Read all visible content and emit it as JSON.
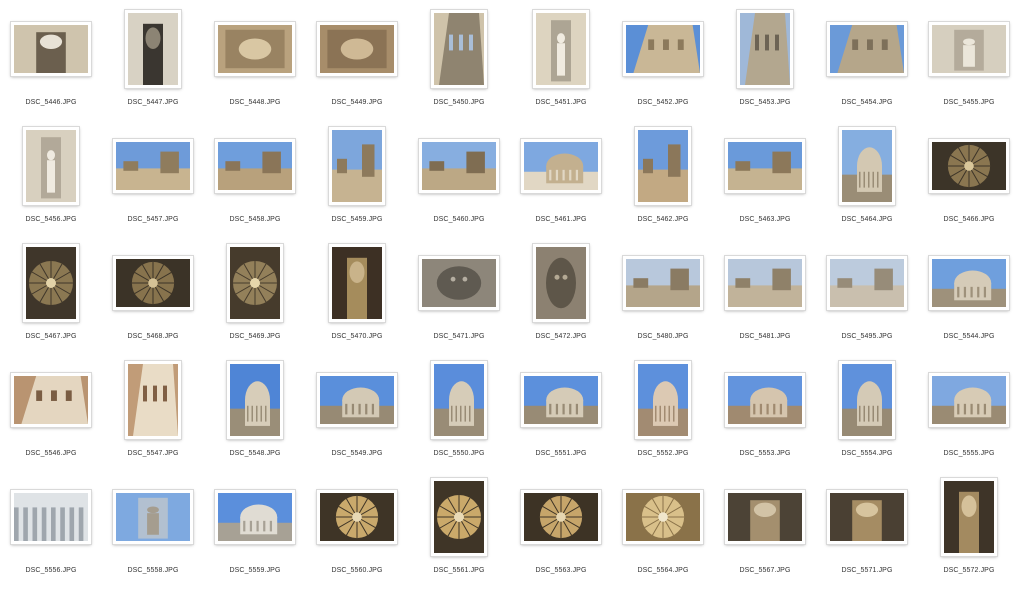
{
  "files": [
    {
      "name": "DSC_5446.JPG",
      "orientation": "landscape",
      "colors": [
        "#cfc4ad",
        "#6b5f4e",
        "#e8e2d6"
      ],
      "icon": "colonnade"
    },
    {
      "name": "DSC_5447.JPG",
      "orientation": "portrait",
      "colors": [
        "#d8d2c4",
        "#3a3630",
        "#8c8474"
      ],
      "icon": "arch"
    },
    {
      "name": "DSC_5448.JPG",
      "orientation": "landscape",
      "colors": [
        "#b9a27e",
        "#7a6446",
        "#d9c7a3"
      ],
      "icon": "ceiling"
    },
    {
      "name": "DSC_5449.JPG",
      "orientation": "landscape",
      "colors": [
        "#a78d6a",
        "#6f5a3f",
        "#cfb995"
      ],
      "icon": "ceiling"
    },
    {
      "name": "DSC_5450.JPG",
      "orientation": "portrait",
      "colors": [
        "#cfc3aa",
        "#8f8470",
        "#a9bed8"
      ],
      "icon": "facade"
    },
    {
      "name": "DSC_5451.JPG",
      "orientation": "portrait",
      "colors": [
        "#ddd4c0",
        "#8e8676",
        "#f0ebe0"
      ],
      "icon": "statue"
    },
    {
      "name": "DSC_5452.JPG",
      "orientation": "landscape",
      "colors": [
        "#5b8fd6",
        "#c9b796",
        "#8c7a5c"
      ],
      "icon": "facade"
    },
    {
      "name": "DSC_5453.JPG",
      "orientation": "portrait",
      "colors": [
        "#9fb8d8",
        "#b3a78f",
        "#6c6354"
      ],
      "icon": "facade"
    },
    {
      "name": "DSC_5454.JPG",
      "orientation": "landscape",
      "colors": [
        "#6b9ad8",
        "#b5a68a",
        "#7d705a"
      ],
      "icon": "facade"
    },
    {
      "name": "DSC_5455.JPG",
      "orientation": "landscape",
      "colors": [
        "#d6cfbf",
        "#9c9384",
        "#ebe6da"
      ],
      "icon": "statue"
    },
    {
      "name": "DSC_5456.JPG",
      "orientation": "portrait",
      "colors": [
        "#d8d0bf",
        "#9a9080",
        "#efeae0"
      ],
      "icon": "statue"
    },
    {
      "name": "DSC_5457.JPG",
      "orientation": "landscape",
      "colors": [
        "#6e9bd9",
        "#c8b490",
        "#8f7c5d"
      ],
      "icon": "rooftop"
    },
    {
      "name": "DSC_5458.JPG",
      "orientation": "landscape",
      "colors": [
        "#6f9edc",
        "#b8a17c",
        "#8a7558"
      ],
      "icon": "rooftop"
    },
    {
      "name": "DSC_5459.JPG",
      "orientation": "portrait",
      "colors": [
        "#7da6dc",
        "#c6b391",
        "#8d7a5c"
      ],
      "icon": "rooftop"
    },
    {
      "name": "DSC_5460.JPG",
      "orientation": "landscape",
      "colors": [
        "#87aee0",
        "#bca885",
        "#7f6d52"
      ],
      "icon": "rooftop"
    },
    {
      "name": "DSC_5461.JPG",
      "orientation": "landscape",
      "colors": [
        "#7ea8e0",
        "#c3b08f",
        "#e1d7c4"
      ],
      "icon": "dome"
    },
    {
      "name": "DSC_5462.JPG",
      "orientation": "portrait",
      "colors": [
        "#6d9bdb",
        "#c2a983",
        "#8b775a"
      ],
      "icon": "rooftop"
    },
    {
      "name": "DSC_5463.JPG",
      "orientation": "landscape",
      "colors": [
        "#6a9ada",
        "#c5b391",
        "#8c785a"
      ],
      "icon": "rooftop"
    },
    {
      "name": "DSC_5464.JPG",
      "orientation": "portrait",
      "colors": [
        "#85aee0",
        "#d3c8b2",
        "#9a8d76"
      ],
      "icon": "dome"
    },
    {
      "name": "DSC_5466.JPG",
      "orientation": "landscape",
      "colors": [
        "#3c3428",
        "#8a7650",
        "#d9c79a"
      ],
      "icon": "cupola"
    },
    {
      "name": "DSC_5467.JPG",
      "orientation": "portrait",
      "colors": [
        "#3f362a",
        "#8b7852",
        "#e3d3a8"
      ],
      "icon": "cupola"
    },
    {
      "name": "DSC_5468.JPG",
      "orientation": "landscape",
      "colors": [
        "#3b3327",
        "#87734d",
        "#d5c296"
      ],
      "icon": "cupola"
    },
    {
      "name": "DSC_5469.JPG",
      "orientation": "portrait",
      "colors": [
        "#463b2c",
        "#93805a",
        "#e6d6ab"
      ],
      "icon": "cupola"
    },
    {
      "name": "DSC_5470.JPG",
      "orientation": "portrait",
      "colors": [
        "#3d3024",
        "#a58c5c",
        "#c9b38a"
      ],
      "icon": "interior"
    },
    {
      "name": "DSC_5471.JPG",
      "orientation": "landscape",
      "colors": [
        "#8d867a",
        "#5f5a51",
        "#b5aea1"
      ],
      "icon": "mosaic"
    },
    {
      "name": "DSC_5472.JPG",
      "orientation": "portrait",
      "colors": [
        "#8c8171",
        "#5e5649",
        "#b4a994"
      ],
      "icon": "mosaic"
    },
    {
      "name": "DSC_5480.JPG",
      "orientation": "landscape",
      "colors": [
        "#b8c8dc",
        "#b4a58a",
        "#8a7b63"
      ],
      "icon": "city"
    },
    {
      "name": "DSC_5481.JPG",
      "orientation": "landscape",
      "colors": [
        "#b7c7db",
        "#c1b39a",
        "#8f8169"
      ],
      "icon": "city"
    },
    {
      "name": "DSC_5495.JPG",
      "orientation": "landscape",
      "colors": [
        "#bccbdd",
        "#c9bfae",
        "#978c79"
      ],
      "icon": "city"
    },
    {
      "name": "DSC_5544.JPG",
      "orientation": "landscape",
      "colors": [
        "#6f9fdd",
        "#d5cbb8",
        "#9e917b"
      ],
      "icon": "dome"
    },
    {
      "name": "DSC_5546.JPG",
      "orientation": "landscape",
      "colors": [
        "#b99471",
        "#e4d6c0",
        "#7a5d43"
      ],
      "icon": "wall"
    },
    {
      "name": "DSC_5547.JPG",
      "orientation": "portrait",
      "colors": [
        "#c19c78",
        "#e9dcc6",
        "#805f44"
      ],
      "icon": "wall"
    },
    {
      "name": "DSC_5548.JPG",
      "orientation": "portrait",
      "colors": [
        "#4f85d6",
        "#d7cdb9",
        "#9a8e78"
      ],
      "icon": "dome"
    },
    {
      "name": "DSC_5549.JPG",
      "orientation": "landscape",
      "colors": [
        "#5a8fdb",
        "#d3c9b5",
        "#978a74"
      ],
      "icon": "dome"
    },
    {
      "name": "DSC_5550.JPG",
      "orientation": "portrait",
      "colors": [
        "#5a8ddb",
        "#d6ccb8",
        "#998c76"
      ],
      "icon": "dome"
    },
    {
      "name": "DSC_5551.JPG",
      "orientation": "landscape",
      "colors": [
        "#5c90dc",
        "#d5cbb7",
        "#988b75"
      ],
      "icon": "dome"
    },
    {
      "name": "DSC_5552.JPG",
      "orientation": "portrait",
      "colors": [
        "#5d90dc",
        "#dcc9b3",
        "#a28b72"
      ],
      "icon": "dome"
    },
    {
      "name": "DSC_5553.JPG",
      "orientation": "landscape",
      "colors": [
        "#6394dd",
        "#d5c5ae",
        "#a08a70"
      ],
      "icon": "dome"
    },
    {
      "name": "DSC_5554.JPG",
      "orientation": "portrait",
      "colors": [
        "#5f91dc",
        "#d4cab6",
        "#978a74"
      ],
      "icon": "dome"
    },
    {
      "name": "DSC_5555.JPG",
      "orientation": "landscape",
      "colors": [
        "#7fa8e0",
        "#d7cbb5",
        "#9a8b73"
      ],
      "icon": "dome"
    },
    {
      "name": "DSC_5556.JPG",
      "orientation": "landscape",
      "colors": [
        "#dfe3e6",
        "#9fa6ad",
        "#f2f3f4"
      ],
      "icon": "ribs"
    },
    {
      "name": "DSC_5558.JPG",
      "orientation": "landscape",
      "colors": [
        "#7ea9e0",
        "#d6d0c4",
        "#a59d8f"
      ],
      "icon": "statues"
    },
    {
      "name": "DSC_5559.JPG",
      "orientation": "landscape",
      "colors": [
        "#5b8fdc",
        "#e0dcd3",
        "#a7a195"
      ],
      "icon": "dome"
    },
    {
      "name": "DSC_5560.JPG",
      "orientation": "landscape",
      "colors": [
        "#3e3426",
        "#c9a96c",
        "#e8d9b5"
      ],
      "icon": "interior-dome"
    },
    {
      "name": "DSC_5561.JPG",
      "orientation": "portrait",
      "colors": [
        "#3f3527",
        "#caa96a",
        "#e9dab6"
      ],
      "icon": "interior-dome"
    },
    {
      "name": "DSC_5563.JPG",
      "orientation": "landscape",
      "colors": [
        "#3d3325",
        "#c6a56a",
        "#e6d6b1"
      ],
      "icon": "interior-dome"
    },
    {
      "name": "DSC_5564.JPG",
      "orientation": "landscape",
      "colors": [
        "#8a7249",
        "#d9c08a",
        "#f0e6cc"
      ],
      "icon": "interior-dome"
    },
    {
      "name": "DSC_5567.JPG",
      "orientation": "landscape",
      "colors": [
        "#4c4336",
        "#a48f6e",
        "#d2c3a6"
      ],
      "icon": "nave"
    },
    {
      "name": "DSC_5571.JPG",
      "orientation": "landscape",
      "colors": [
        "#4a4033",
        "#a58c63",
        "#d7c49e"
      ],
      "icon": "nave"
    },
    {
      "name": "DSC_5572.JPG",
      "orientation": "portrait",
      "colors": [
        "#3e3428",
        "#a38a60",
        "#d5c19a"
      ],
      "icon": "nave"
    }
  ]
}
